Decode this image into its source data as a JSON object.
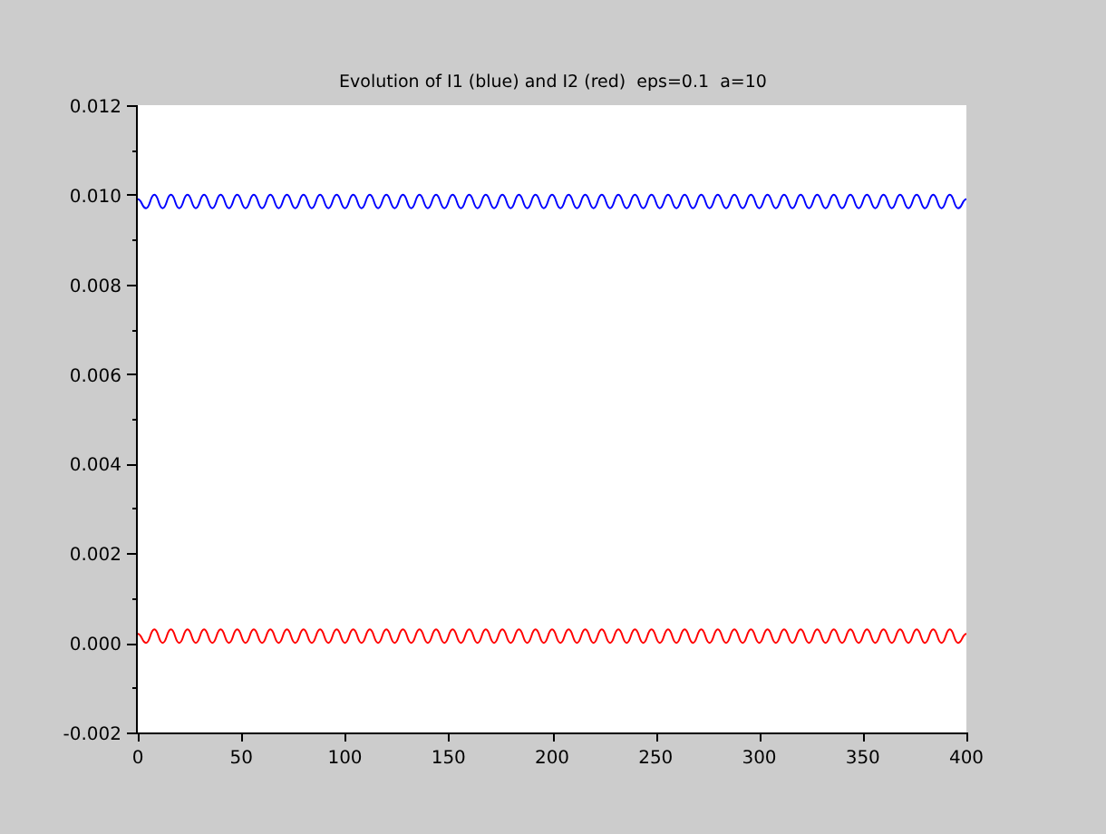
{
  "window": {
    "kind": "plot"
  },
  "chart": {
    "chart_data": {
      "type": "line",
      "title": "Evolution of I1 (blue) and I2 (red)  eps=0.1  a=10",
      "x": [
        0,
        4,
        8,
        12,
        16,
        20,
        24,
        28,
        32,
        36,
        40,
        44,
        48,
        52,
        56,
        60,
        64,
        68,
        72,
        76,
        80,
        84,
        88,
        92,
        96,
        100,
        104,
        108,
        112,
        116,
        120,
        124,
        128,
        132,
        136,
        140,
        144,
        148,
        152,
        156,
        160,
        164,
        168,
        172,
        176,
        180,
        184,
        188,
        192,
        196,
        200,
        204,
        208,
        212,
        216,
        220,
        224,
        228,
        232,
        236,
        240,
        244,
        248,
        252,
        256,
        260,
        264,
        268,
        272,
        276,
        280,
        284,
        288,
        292,
        296,
        300,
        304,
        308,
        312,
        316,
        320,
        324,
        328,
        332,
        336,
        340,
        344,
        348,
        352,
        356,
        360,
        364,
        368,
        372,
        376,
        380,
        384,
        388,
        392,
        396,
        400
      ],
      "series": [
        {
          "color": "#0000ff",
          "values": [
            0.0099,
            0.0097,
            0.01,
            0.0097,
            0.01,
            0.0097,
            0.01,
            0.0097,
            0.01,
            0.0097,
            0.01,
            0.0097,
            0.01,
            0.0097,
            0.01,
            0.0097,
            0.01,
            0.0097,
            0.01,
            0.0097,
            0.01,
            0.0097,
            0.01,
            0.0097,
            0.01,
            0.0097,
            0.01,
            0.0097,
            0.01,
            0.0097,
            0.01,
            0.0097,
            0.01,
            0.0097,
            0.01,
            0.0097,
            0.01,
            0.0097,
            0.01,
            0.0097,
            0.01,
            0.0097,
            0.01,
            0.0097,
            0.01,
            0.0097,
            0.01,
            0.0097,
            0.01,
            0.0097,
            0.01,
            0.0097,
            0.01,
            0.0097,
            0.01,
            0.0097,
            0.01,
            0.0097,
            0.01,
            0.0097,
            0.01,
            0.0097,
            0.01,
            0.0097,
            0.01,
            0.0097,
            0.01,
            0.0097,
            0.01,
            0.0097,
            0.01,
            0.0097,
            0.01,
            0.0097,
            0.01,
            0.0097,
            0.01,
            0.0097,
            0.01,
            0.0097,
            0.01,
            0.0097,
            0.01,
            0.0097,
            0.01,
            0.0097,
            0.01,
            0.0097,
            0.01,
            0.0097,
            0.01,
            0.0097,
            0.01,
            0.0097,
            0.01,
            0.0097,
            0.01,
            0.0097,
            0.01,
            0.0097,
            0.0099
          ]
        },
        {
          "color": "#ff0000",
          "values": [
            0.0002,
            0,
            0.0003,
            0,
            0.0003,
            0,
            0.0003,
            0,
            0.0003,
            0,
            0.0003,
            0,
            0.0003,
            0,
            0.0003,
            0,
            0.0003,
            0,
            0.0003,
            0,
            0.0003,
            0,
            0.0003,
            0,
            0.0003,
            0,
            0.0003,
            0,
            0.0003,
            0,
            0.0003,
            0,
            0.0003,
            0,
            0.0003,
            0,
            0.0003,
            0,
            0.0003,
            0,
            0.0003,
            0,
            0.0003,
            0,
            0.0003,
            0,
            0.0003,
            0,
            0.0003,
            0,
            0.0003,
            0,
            0.0003,
            0,
            0.0003,
            0,
            0.0003,
            0,
            0.0003,
            0,
            0.0003,
            0,
            0.0003,
            0,
            0.0003,
            0,
            0.0003,
            0,
            0.0003,
            0,
            0.0003,
            0,
            0.0003,
            0,
            0.0003,
            0,
            0.0003,
            0,
            0.0003,
            0,
            0.0003,
            0,
            0.0003,
            0,
            0.0003,
            0,
            0.0003,
            0,
            0.0003,
            0,
            0.0003,
            0,
            0.0003,
            0,
            0.0003,
            0,
            0.0003,
            0,
            0.0003,
            0,
            0.0002
          ]
        }
      ],
      "xlim": [
        0,
        400
      ],
      "ylim": [
        -0.002,
        0.012
      ],
      "xticks": [
        0,
        50,
        100,
        150,
        200,
        250,
        300,
        350,
        400
      ],
      "yticks": [
        {
          "value": -0.002,
          "label": "-0.002"
        },
        {
          "value": 0,
          "label": "0.000"
        },
        {
          "value": 0.002,
          "label": "0.002"
        },
        {
          "value": 0.004,
          "label": "0.004"
        },
        {
          "value": 0.006,
          "label": "0.006"
        },
        {
          "value": 0.008,
          "label": "0.008"
        },
        {
          "value": 0.01,
          "label": "0.010"
        },
        {
          "value": 0.012,
          "label": "0.012"
        }
      ]
    }
  }
}
